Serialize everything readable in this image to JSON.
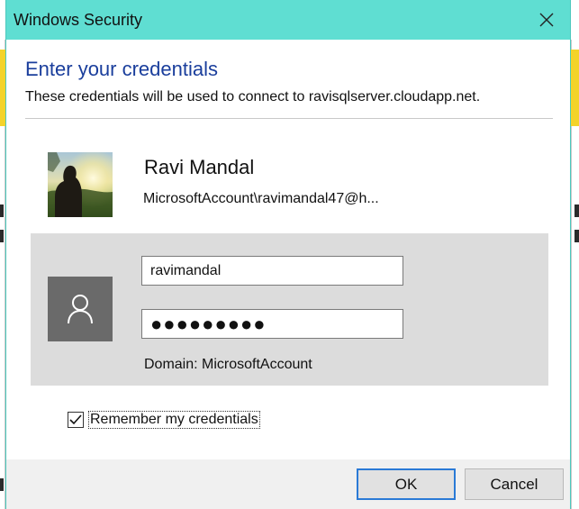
{
  "window": {
    "title": "Windows Security",
    "close_icon": "close-icon"
  },
  "header": {
    "heading": "Enter your credentials",
    "description": "These credentials will be used to connect to ravisqlserver.cloudapp.net."
  },
  "account": {
    "name": "Ravi Mandal",
    "id": "MicrosoftAccount\\ravimandal47@h..."
  },
  "credentials": {
    "user_icon": "user-icon",
    "username_value": "ravimandal",
    "password_display": "●●●●●●●●●",
    "domain": "Domain: MicrosoftAccount"
  },
  "remember": {
    "label": "Remember my credentials",
    "checked": true
  },
  "buttons": {
    "ok": "OK",
    "cancel": "Cancel"
  },
  "colors": {
    "titlebar": "#5fded2",
    "heading": "#1a3e9c",
    "panel": "#dcdcdc",
    "user_tile": "#6a6a6a",
    "default_button_border": "#2a7ad6"
  }
}
